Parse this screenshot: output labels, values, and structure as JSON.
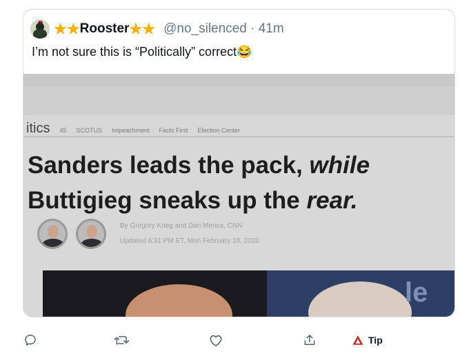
{
  "tweet": {
    "display_name": "Rooster",
    "handle_time": "@no_silenced · 41m",
    "text": "I’m not sure this is “Politically” correct😂"
  },
  "image": {
    "nav_brand": "itics",
    "nav_items": [
      "45",
      "SCOTUS",
      "Impeachment",
      "Facts First",
      "Election Center"
    ],
    "headline_line1": "Sanders leads the pack,",
    "headline_line1_italic": "while",
    "headline_line2_start": "Buttigieg sneaks up the",
    "headline_line2_italic": "rear.",
    "byline": "By Gregory Krieg and Dan Merica, CNN",
    "updated": "Updated 6:31 PM ET, Mon February 10, 2020",
    "sign_text": "le"
  },
  "actions": {
    "tip_label": "Tip"
  },
  "colors": {
    "star": "#f5b000",
    "action_icon": "#536471",
    "tip_icon": "#c62828"
  },
  "icons": [
    "avatar-rooster",
    "star-icon",
    "reply-icon",
    "retweet-icon",
    "like-icon",
    "share-icon",
    "tip-icon"
  ]
}
